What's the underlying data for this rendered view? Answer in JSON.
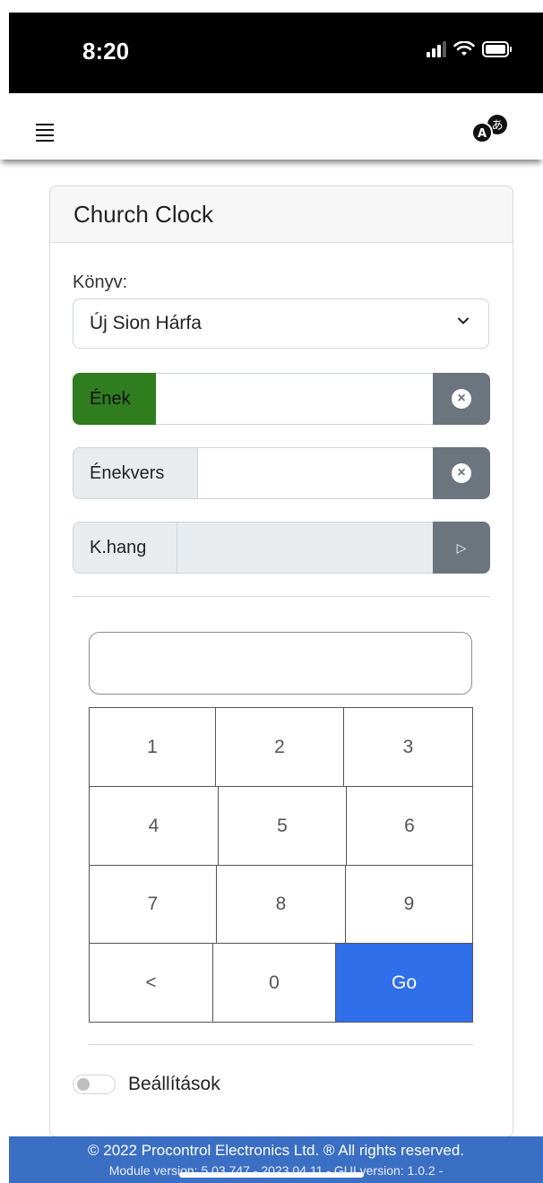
{
  "status_bar": {
    "time": "8:20"
  },
  "card": {
    "title": "Church Clock"
  },
  "book": {
    "label": "Könyv:",
    "selected": "Új Sion Hárfa"
  },
  "inputs": [
    {
      "label": "Ének",
      "value": ""
    },
    {
      "label": "Énekvers",
      "value": ""
    },
    {
      "label": "K.hang",
      "value": ""
    }
  ],
  "keypad": {
    "display_value": "",
    "keys": [
      "1",
      "2",
      "3",
      "4",
      "5",
      "6",
      "7",
      "8",
      "9",
      "<",
      "0",
      "Go"
    ]
  },
  "settings": {
    "label": "Beállítások",
    "enabled": false
  },
  "footer": {
    "copyright": "© 2022 Procontrol Electronics Ltd. ® All rights reserved.",
    "version": "Module version: 5.03.747 - 2023.04.11 - GUI version: 1.0.2 -"
  },
  "colors": {
    "accent_green": "#2f7d1e",
    "go_blue": "#2f6fea",
    "footer_blue": "#3a6fc3",
    "side_button_gray": "#6c757d"
  },
  "icons": {
    "menu": "hamburger-icon",
    "language": "translate-icon",
    "clear": "clear-circle-icon",
    "play": "play-icon",
    "dropdown": "chevron-down-icon"
  }
}
